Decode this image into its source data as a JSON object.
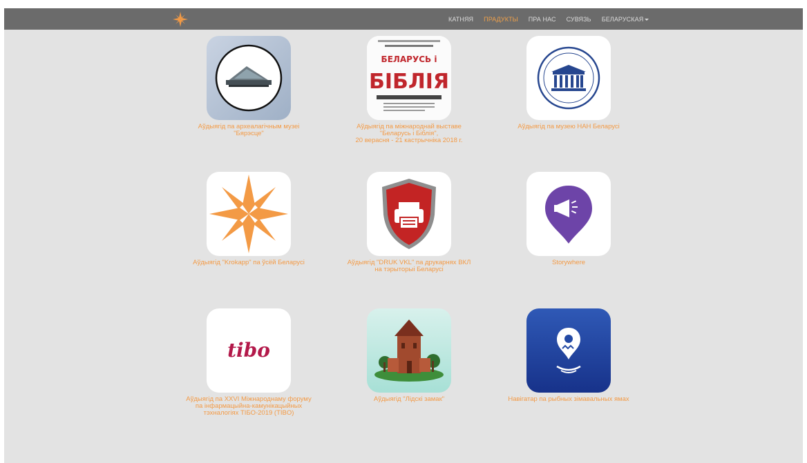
{
  "nav": {
    "items": [
      {
        "label": "КАТНЯЯ"
      },
      {
        "label": "ПРАДУКТЫ",
        "active": true
      },
      {
        "label": "ПРА НАС"
      },
      {
        "label": "СУВЯЗЬ"
      },
      {
        "label": "БЕЛАРУСКАЯ"
      }
    ]
  },
  "products": [
    {
      "icon": "museum-building-icon",
      "caption": [
        "Аўдыягід па археалагічным музеі",
        "\"Бярэсце\""
      ]
    },
    {
      "icon": "book-poster-icon",
      "caption": [
        "Аўдыягід па міжнароднай выставе",
        "\"Беларусь і Біблія\",",
        "20 верасня - 21 кастрычніка 2018 г."
      ],
      "poster": {
        "line1": "БЕЛАРУСЬ і",
        "line2": "БІБЛІЯ"
      }
    },
    {
      "icon": "academy-emblem-icon",
      "caption": [
        "Аўдыягід па музею НАН Беларусі"
      ]
    },
    {
      "icon": "krokapp-star-icon",
      "caption": [
        "Аўдыягід \"Krokapp\" па ўсёй Беларусі"
      ]
    },
    {
      "icon": "printer-shield-icon",
      "caption": [
        "Аўдыягід \"DRUK VKL\" па друкарнях ВКЛ",
        "на тэрыторыі Беларусі"
      ]
    },
    {
      "icon": "megaphone-pin-icon",
      "caption": [
        "Storywhere"
      ]
    },
    {
      "icon": "tibo-logo-icon",
      "caption": [
        "Аўдыягід па XXVI Міжнароднаму форуму",
        "па інфармацыйна-камунікацыйных",
        "тэхналогіях ТІБО-2019 (TIBO)"
      ],
      "logo_text": "tibo"
    },
    {
      "icon": "castle-tower-icon",
      "caption": [
        "Аўдыягід \"Лідскі замак\""
      ]
    },
    {
      "icon": "fish-location-icon",
      "caption": [
        "Навігатар па рыбных зімавальных ямах"
      ]
    }
  ],
  "colors": {
    "accent": "#f39a45",
    "navbar": "#6b6b6b",
    "background": "#e3e3e3"
  }
}
